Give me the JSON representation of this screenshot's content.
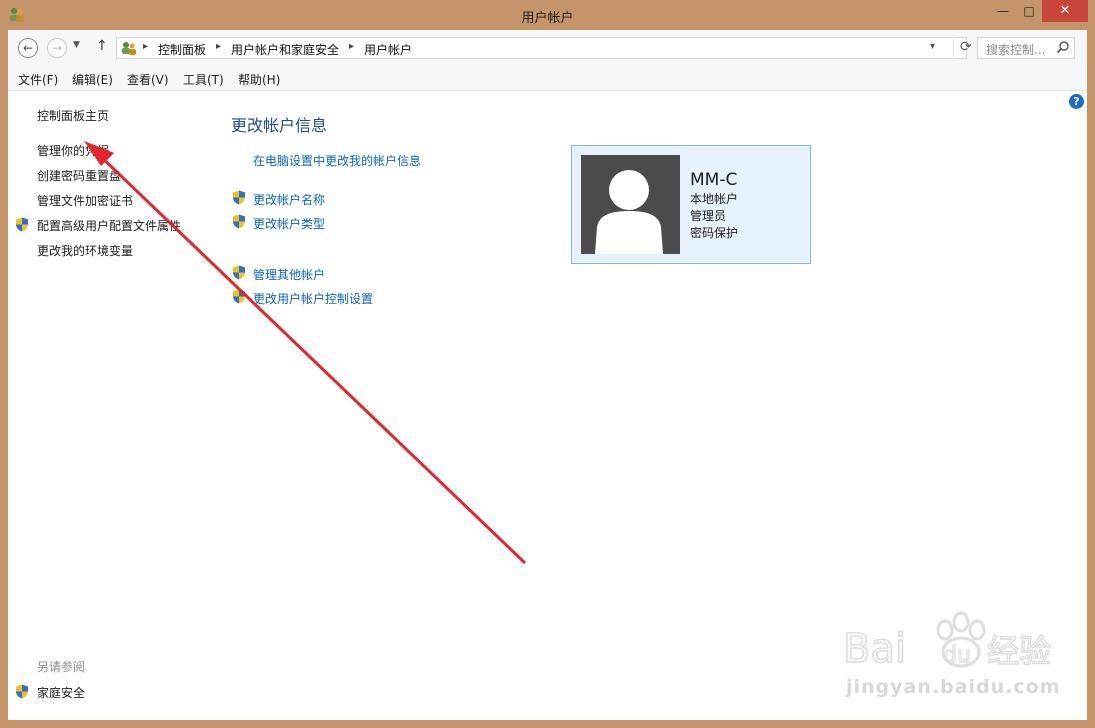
{
  "window": {
    "title": "用户帐户",
    "close_glyph": "✕",
    "min_glyph": "—",
    "max_glyph": "□"
  },
  "address": {
    "crumbs": [
      "控制面板",
      "用户帐户和家庭安全",
      "用户帐户"
    ],
    "separator": "▸",
    "search_placeholder": "搜索控制..."
  },
  "menu": [
    "文件(F)",
    "编辑(E)",
    "查看(V)",
    "工具(T)",
    "帮助(H)"
  ],
  "sidebar": {
    "items": [
      {
        "label": "控制面板主页",
        "shield": false
      },
      {
        "label": "管理你的凭据",
        "shield": false
      },
      {
        "label": "创建密码重置盘",
        "shield": false
      },
      {
        "label": "管理文件加密证书",
        "shield": false
      },
      {
        "label": "配置高级用户配置文件属性",
        "shield": true
      },
      {
        "label": "更改我的环境变量",
        "shield": false
      }
    ],
    "see_also_title": "另请参阅",
    "see_also": [
      {
        "label": "家庭安全",
        "shield": true
      }
    ]
  },
  "main": {
    "heading": "更改帐户信息",
    "links": [
      {
        "label": "在电脑设置中更改我的帐户信息",
        "shield": false
      },
      {
        "label": "更改帐户名称",
        "shield": true
      },
      {
        "label": "更改帐户类型",
        "shield": true
      },
      {
        "label": "管理其他帐户",
        "shield": true
      },
      {
        "label": "更改用户帐户控制设置",
        "shield": true
      }
    ]
  },
  "account": {
    "name": "MM-C",
    "type": "本地帐户",
    "role": "管理员",
    "protection": "密码保护"
  },
  "watermark": {
    "text": "jingyan.baidu.com",
    "logo_text": "Bai du 经验"
  },
  "colors": {
    "link": "#0b66c1",
    "heading": "#1e4e8c",
    "frame": "#c4956b",
    "annotation_arrow": "#e3262b"
  }
}
